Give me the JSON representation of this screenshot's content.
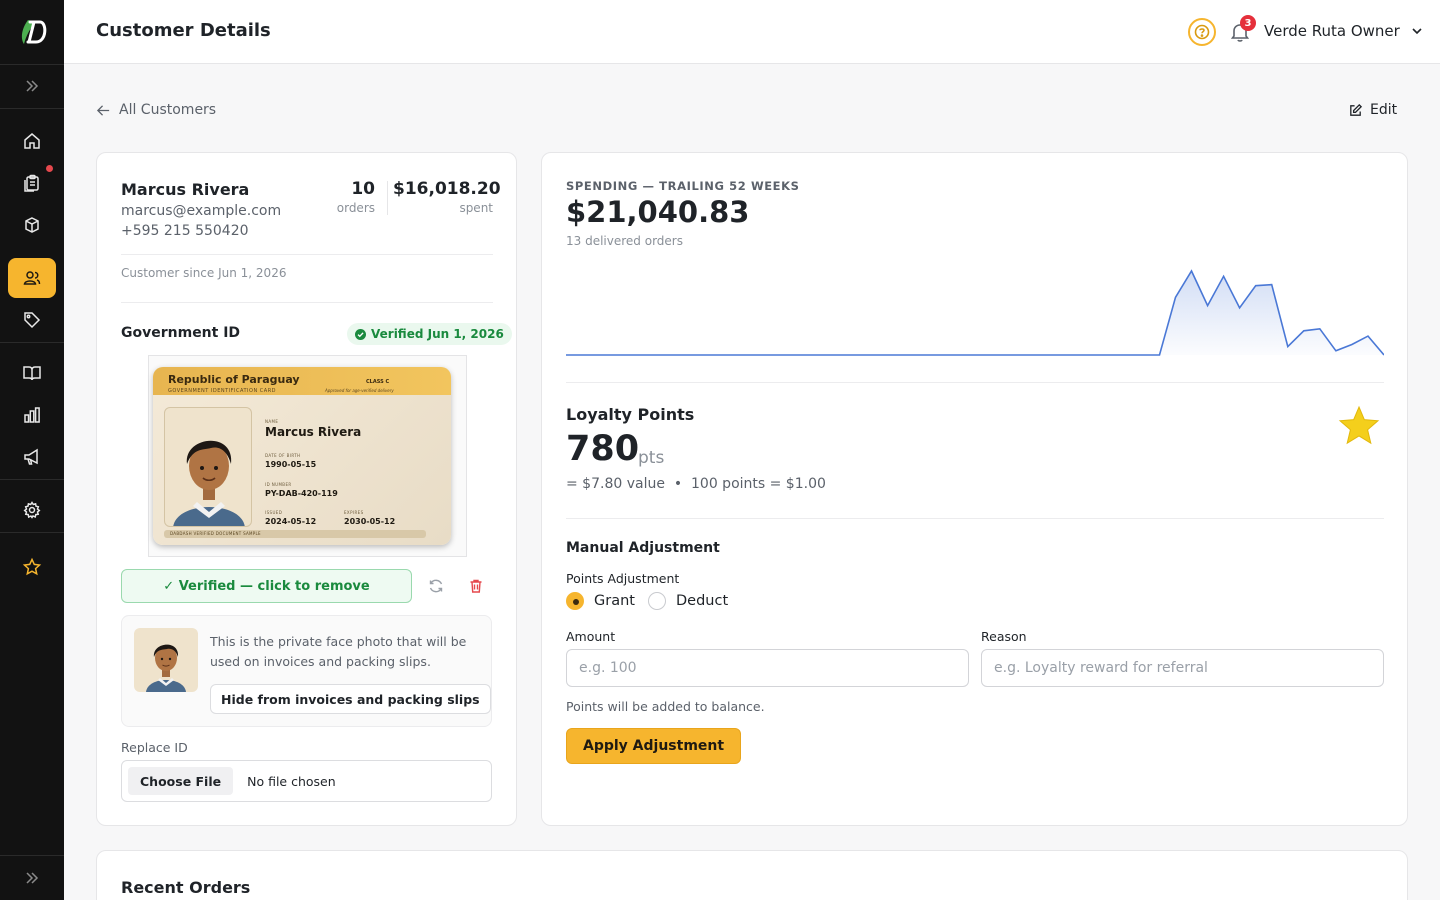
{
  "header": {
    "title": "Customer Details",
    "notification_count": "3",
    "user_name": "Verde Ruta Owner"
  },
  "nav": {
    "back_label": "All Customers",
    "edit_label": "Edit"
  },
  "sidebar": {
    "items": [
      "expand",
      "home",
      "orders",
      "products",
      "customers",
      "tags",
      "catalog",
      "analytics",
      "marketing",
      "settings",
      "favorites"
    ],
    "active": "customers",
    "accent": "#f6b52e"
  },
  "customer": {
    "name": "Marcus Rivera",
    "email": "marcus@example.com",
    "phone": "+595 215 550420",
    "orders_count": "10",
    "orders_label": "orders",
    "spent_amount": "$16,018.20",
    "spent_label": "spent",
    "since": "Customer since Jun 1, 2026"
  },
  "government_id": {
    "title": "Government ID",
    "verified_badge": "Verified Jun 1, 2026",
    "card": {
      "country": "Republic of Paraguay",
      "subtitle": "GOVERNMENT IDENTIFICATION CARD",
      "class": "CLASS C",
      "approved": "Approved for age-verified delivery",
      "name_label": "NAME",
      "name": "Marcus Rivera",
      "dob_label": "DATE OF BIRTH",
      "dob": "1990-05-15",
      "id_label": "ID NUMBER",
      "id_number": "PY-DAB-420-119",
      "issued_label": "ISSUED",
      "issued": "2024-05-12",
      "expires_label": "EXPIRES",
      "expires": "2030-05-12",
      "footer": "DABDASH VERIFIED DOCUMENT SAMPLE"
    },
    "verified_button": "✓ Verified — click to remove",
    "face_text": "This is the private face photo that will be used on invoices and packing slips.",
    "hide_button": "Hide from invoices and packing slips",
    "replace_label": "Replace ID",
    "choose_file": "Choose File",
    "no_file": "No file chosen"
  },
  "spending": {
    "title": "SPENDING — TRAILING 52 WEEKS",
    "total": "$21,040.83",
    "subtitle": "13 delivered orders"
  },
  "chart_data": {
    "type": "area",
    "title": "",
    "xlabel": "",
    "ylabel": "",
    "grid": false,
    "color": "#4a78d6",
    "values": [
      0,
      0,
      0,
      0,
      0,
      0,
      0,
      0,
      0,
      0,
      0,
      0,
      0,
      0,
      0,
      0,
      0,
      0,
      0,
      0,
      0,
      0,
      0,
      0,
      0,
      0,
      0,
      0,
      0,
      0,
      0,
      0,
      0,
      0,
      0,
      0,
      0,
      0,
      55,
      80,
      47,
      75,
      45,
      66,
      67,
      8,
      23,
      25,
      4,
      10,
      18,
      0
    ]
  },
  "loyalty": {
    "title": "Loyalty Points",
    "points": "780",
    "unit": "pts",
    "value_line": "= $7.80 value  •  100 points = $1.00"
  },
  "adjustment": {
    "title": "Manual Adjustment",
    "points_label": "Points Adjustment",
    "grant_label": "Grant",
    "deduct_label": "Deduct",
    "selected": "Grant",
    "amount_label": "Amount",
    "amount_placeholder": "e.g. 100",
    "reason_label": "Reason",
    "reason_placeholder": "e.g. Loyalty reward for referral",
    "hint": "Points will be added to balance.",
    "apply_button": "Apply Adjustment"
  },
  "recent_orders": {
    "title": "Recent Orders"
  }
}
